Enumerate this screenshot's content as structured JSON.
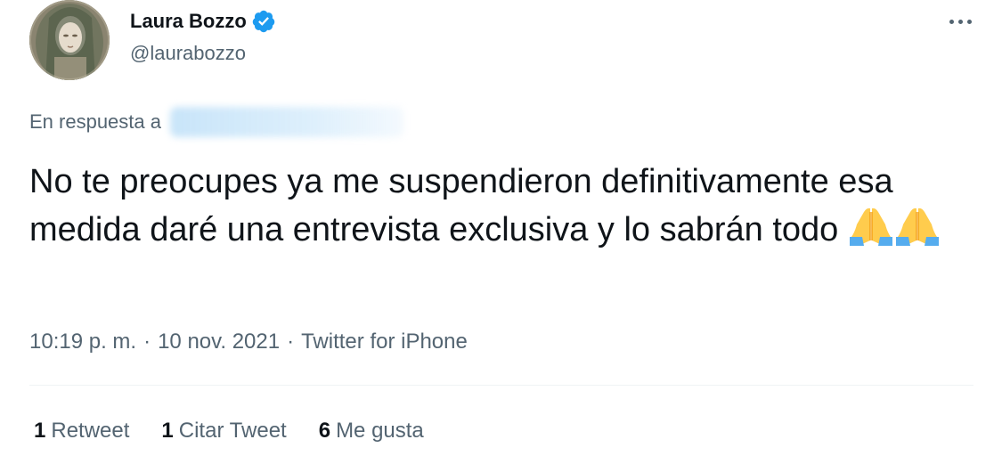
{
  "author": {
    "display_name": "Laura Bozzo",
    "handle": "@laurabozzo",
    "verified": true,
    "verified_color": "#1d9bf0"
  },
  "reply": {
    "prefix": "En respuesta a",
    "target_redacted": true
  },
  "tweet": {
    "text": "No te preocupes ya me suspendieron definitivamente esa medida daré una entrevista exclusiva y lo sabrán todo",
    "emojis": [
      "folded-hands",
      "folded-hands"
    ]
  },
  "meta": {
    "time": "10:19 p. m.",
    "date": "10 nov. 2021",
    "source": "Twitter for iPhone",
    "separator": "·"
  },
  "stats": [
    {
      "count": "1",
      "label": "Retweet"
    },
    {
      "count": "1",
      "label": "Citar Tweet"
    },
    {
      "count": "6",
      "label": "Me gusta"
    }
  ],
  "icons": {
    "more": "more-horizontal-icon",
    "verified": "verified-badge-icon"
  },
  "colors": {
    "text_primary": "#0f1419",
    "text_secondary": "#536471",
    "accent": "#1d9bf0",
    "divider": "#eff3f4"
  }
}
